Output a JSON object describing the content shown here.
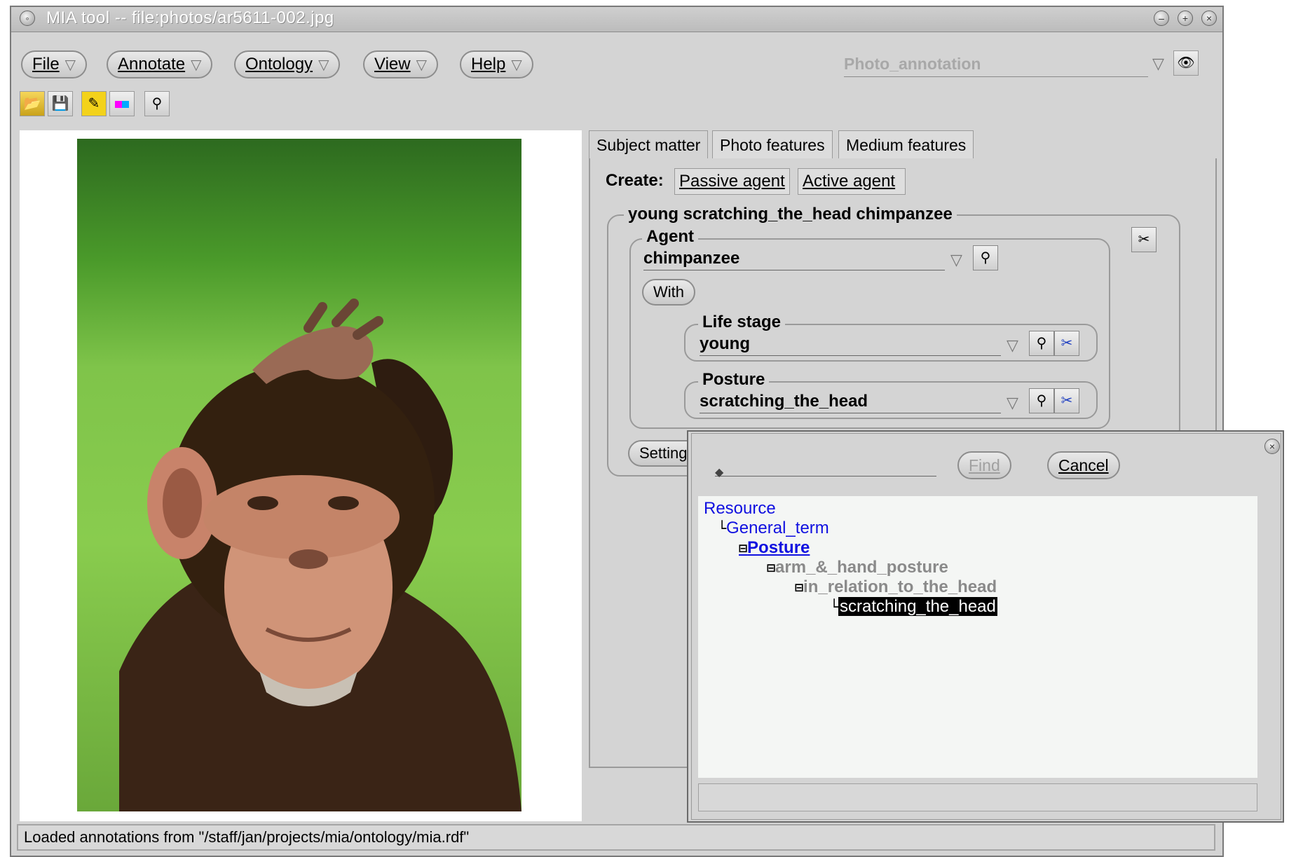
{
  "window": {
    "title": "MIA tool -- file:photos/ar5611-002.jpg"
  },
  "menubar": {
    "items": [
      {
        "label": "File"
      },
      {
        "label": "Annotate"
      },
      {
        "label": "Ontology"
      },
      {
        "label": "View"
      },
      {
        "label": "Help"
      }
    ],
    "annotation_combo_value": "Photo_annotation"
  },
  "toolbar": {
    "icons": [
      "open-folder-icon",
      "save-icon",
      "annotate-image-icon",
      "color-features-icon",
      "find-icon"
    ]
  },
  "image": {
    "subject": "chimpanzee photo"
  },
  "tabs": [
    {
      "label": "Subject matter",
      "active": true
    },
    {
      "label": "Photo features",
      "active": false
    },
    {
      "label": "Medium features",
      "active": false
    }
  ],
  "create": {
    "label": "Create:",
    "passive_agent": "Passive agent",
    "active_agent": "Active agent"
  },
  "annotation_group": {
    "title": "young scratching_the_head chimpanzee",
    "agent": {
      "legend": "Agent",
      "value": "chimpanzee"
    },
    "with_button": "With",
    "life_stage": {
      "legend": "Life stage",
      "value": "young"
    },
    "posture": {
      "legend": "Posture",
      "value": "scratching_the_head"
    },
    "setting_button": "Setting"
  },
  "find_dialog": {
    "find_button": "Find",
    "cancel_button": "Cancel",
    "tree": [
      {
        "label": "Resource",
        "connector": "",
        "style": "link"
      },
      {
        "label": "General_term",
        "connector": "└",
        "style": "link"
      },
      {
        "label": "Posture",
        "connector": "⊟",
        "style": "link-bold"
      },
      {
        "label": "arm_&_hand_posture",
        "connector": "⊟",
        "style": "grey"
      },
      {
        "label": "in_relation_to_the_head",
        "connector": "⊟",
        "style": "grey"
      },
      {
        "label": "scratching_the_head",
        "connector": "└",
        "style": "selected"
      }
    ]
  },
  "status": {
    "text": "Loaded annotations from \"/staff/jan/projects/mia/ontology/mia.rdf\""
  },
  "colors": {
    "link": "#1010e0",
    "grey_text": "#8a8a8a",
    "selection_bg": "#000000",
    "selection_fg": "#ffffff",
    "window_bg": "#d4d4d4"
  }
}
